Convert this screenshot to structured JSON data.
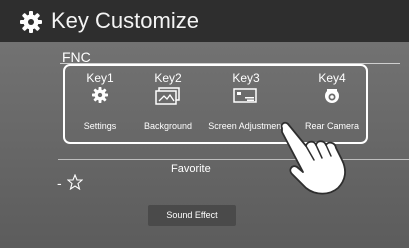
{
  "header": {
    "title": "Key Customize",
    "icon": "gear-icon"
  },
  "fnc": {
    "label": "FNC",
    "keys": [
      {
        "name": "Key1",
        "icon": "gear-icon",
        "label": "Settings"
      },
      {
        "name": "Key2",
        "icon": "background-icon",
        "label": "Background"
      },
      {
        "name": "Key3",
        "icon": "screen-adjustment-icon",
        "label": "Screen Adjustment"
      },
      {
        "name": "Key4",
        "icon": "rear-camera-icon",
        "label": "Rear Camera"
      }
    ]
  },
  "favorite": {
    "prefix": "-",
    "icon": "star-icon",
    "label": "Favorite",
    "button_label": "Sound Effect"
  },
  "colors": {
    "header_bg": "#2e2e2e",
    "body_bg": "#6b6b6b",
    "text": "#ffffff"
  }
}
